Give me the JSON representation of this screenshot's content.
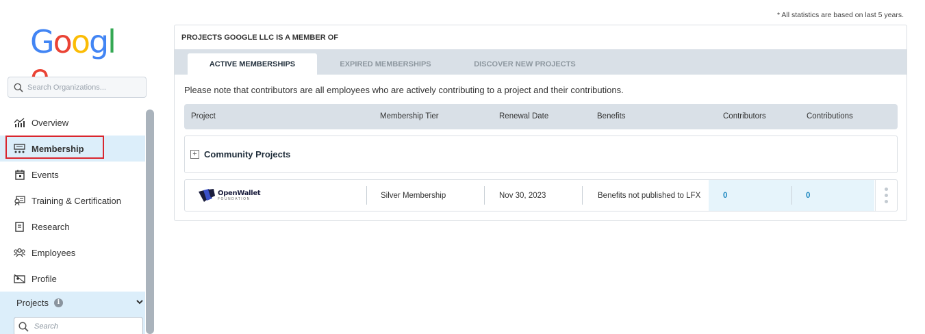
{
  "sidebar": {
    "logo": "Google",
    "search_placeholder": "Search Organizations...",
    "nav": [
      {
        "label": "Overview",
        "icon": "chart-icon"
      },
      {
        "label": "Membership",
        "icon": "membership-icon",
        "active": true
      },
      {
        "label": "Events",
        "icon": "calendar-icon"
      },
      {
        "label": "Training & Certification",
        "icon": "certificate-icon"
      },
      {
        "label": "Research",
        "icon": "book-icon"
      },
      {
        "label": "Employees",
        "icon": "people-icon"
      },
      {
        "label": "Profile",
        "icon": "profile-icon"
      }
    ],
    "projects": {
      "label": "Projects",
      "info_icon": "i",
      "search_placeholder": "Search"
    }
  },
  "main": {
    "stats_note": "* All statistics are based on last 5 years.",
    "panel_title": "PROJECTS GOOGLE LLC IS A MEMBER OF",
    "tabs": [
      {
        "label": "ACTIVE MEMBERSHIPS",
        "active": true
      },
      {
        "label": "EXPIRED MEMBERSHIPS",
        "active": false
      },
      {
        "label": "DISCOVER NEW PROJECTS",
        "active": false
      }
    ],
    "contrib_note": "Please note that contributors are all employees who are actively contributing to a project and their contributions.",
    "columns": [
      "Project",
      "Membership Tier",
      "Renewal Date",
      "Benefits",
      "Contributors",
      "Contributions"
    ],
    "group": {
      "label": "Community Projects",
      "toggle": "+"
    },
    "rows": [
      {
        "project_logo_name": "OpenWallet",
        "project_logo_sub": "FOUNDATION",
        "tier": "Silver Membership",
        "renewal": "Nov 30, 2023",
        "benefits": "Benefits not published to LFX",
        "contributors": "0",
        "contributions": "0"
      }
    ]
  },
  "colors": {
    "accent": "#1d88c0",
    "active_nav": "#dceefa",
    "highlight": "#d9262e",
    "google_blue": "#4285F4",
    "google_red": "#EA4335",
    "google_yellow": "#FBBC05",
    "google_green": "#34A853"
  }
}
